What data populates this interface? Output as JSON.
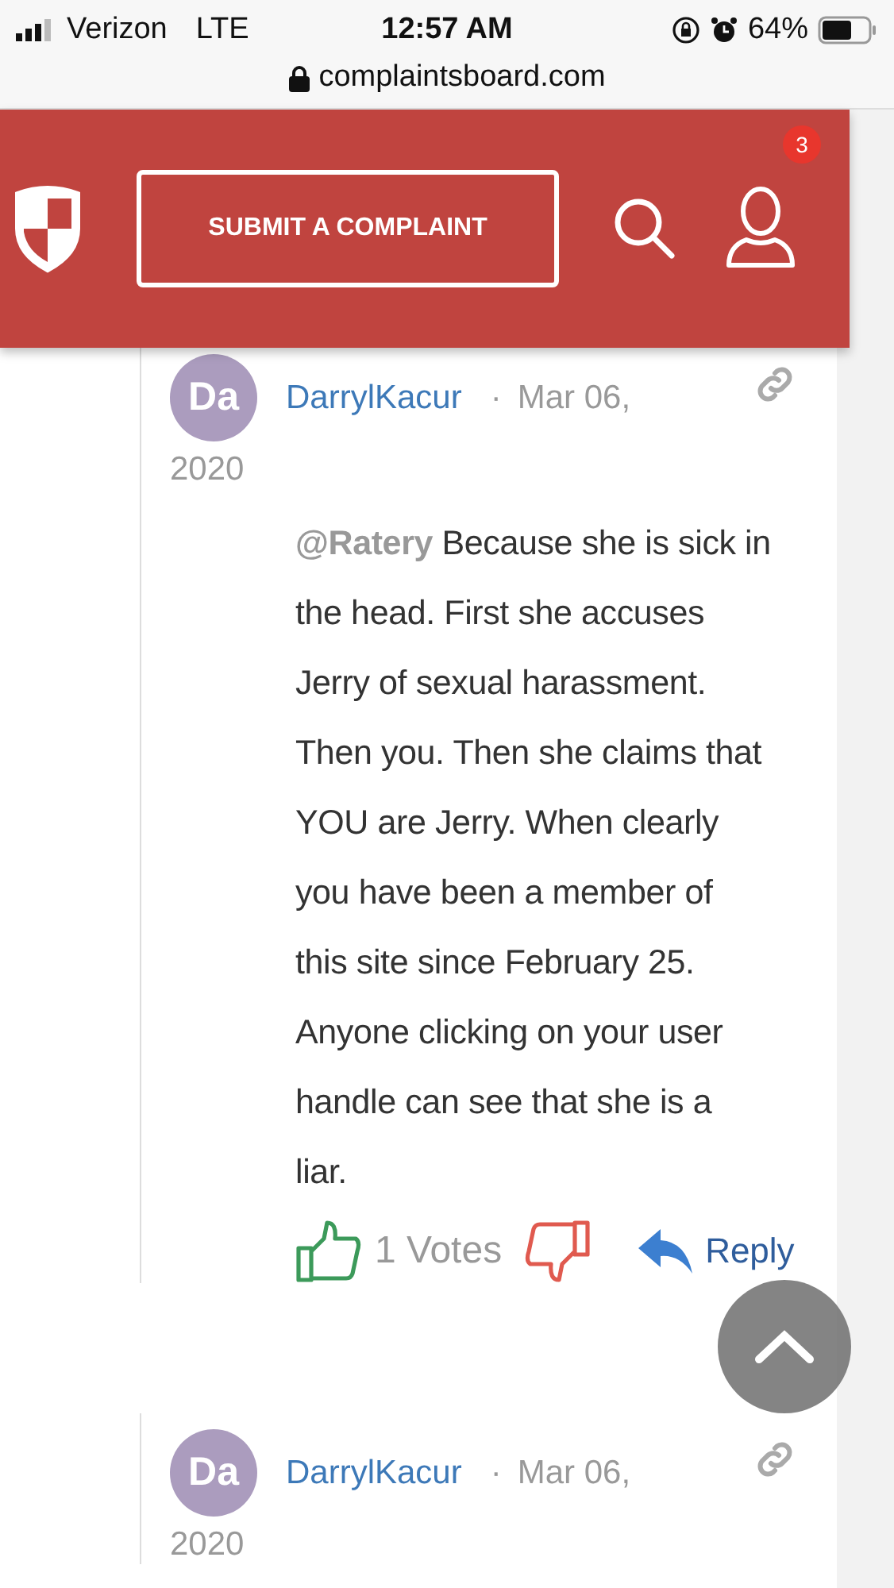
{
  "status_bar": {
    "carrier": "Verizon",
    "network": "LTE",
    "time": "12:57 AM",
    "battery": "64%"
  },
  "url_bar": {
    "url": "complaintsboard.com"
  },
  "header": {
    "submit_button": "SUBMIT A COMPLAINT",
    "notification_count": "3"
  },
  "comments": [
    {
      "avatar": "Da",
      "author": "DarrylKacur",
      "separator": "·",
      "date_part": "Mar 06,",
      "year": "2020",
      "mention": "@Ratery",
      "body": "Because she is sick in the head. First she accuses Jerry of sexual harassment. Then you. Then she claims that YOU are Jerry. When clearly you have been a member of this site since February 25. Anyone clicking on your user handle can see that she is a liar.",
      "votes": "1 Votes",
      "reply": "Reply"
    },
    {
      "avatar": "Da",
      "author": "DarrylKacur",
      "separator": "·",
      "date_part": "Mar 06,",
      "year": "2020"
    }
  ]
}
